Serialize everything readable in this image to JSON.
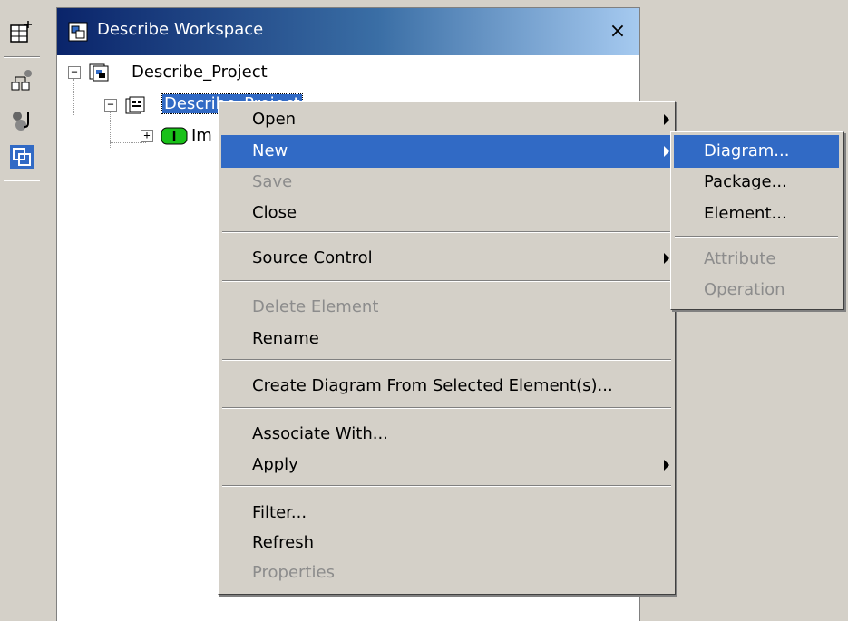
{
  "toolbar": {
    "icons": [
      "new-item-icon",
      "class-tool-icon",
      "component-tool-icon",
      "workspace-icon"
    ]
  },
  "workspace": {
    "title": "Describe Workspace",
    "close_glyph": "×",
    "tree": {
      "root_label": "Describe_Project",
      "child_label": "Describe_Project",
      "grandchild_label": "Im"
    }
  },
  "context_menu": {
    "items": [
      {
        "label": "Open"
      },
      {
        "label": "New"
      },
      {
        "label": "Save"
      },
      {
        "label": "Close"
      },
      {
        "label": "Source Control"
      },
      {
        "label": "Delete Element"
      },
      {
        "label": "Rename"
      },
      {
        "label": "Create Diagram From Selected Element(s)..."
      },
      {
        "label": "Associate With..."
      },
      {
        "label": "Apply"
      },
      {
        "label": "Filter..."
      },
      {
        "label": "Refresh"
      },
      {
        "label": "Properties"
      }
    ]
  },
  "submenu": {
    "items": [
      {
        "label": "Diagram..."
      },
      {
        "label": "Package..."
      },
      {
        "label": "Element..."
      },
      {
        "label": "Attribute"
      },
      {
        "label": "Operation"
      }
    ]
  },
  "colors": {
    "selection": "#316ac5",
    "disabled_text": "#8c8c8c",
    "title_gradient_start": "#0a246a",
    "title_gradient_end": "#a6caf0"
  }
}
